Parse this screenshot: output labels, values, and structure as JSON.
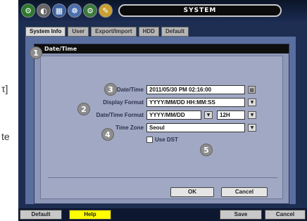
{
  "doc_fragments": [
    "τ]",
    "te"
  ],
  "window": {
    "title": "SYSTEM"
  },
  "toolbar": {
    "icons": [
      "system-icon",
      "storage-icon",
      "calendar-icon",
      "network-icon",
      "record-icon",
      "settings-icon"
    ]
  },
  "tabs": [
    {
      "label": "System Info",
      "active": true
    },
    {
      "label": "User",
      "active": false
    },
    {
      "label": "Export/Import",
      "active": false
    },
    {
      "label": "HDD",
      "active": false
    },
    {
      "label": "Default",
      "active": false
    }
  ],
  "dialog": {
    "title": "Date/Time",
    "fields": {
      "date_time": {
        "label": "Date/Time",
        "value": "2011/05/30 PM 02:16:00"
      },
      "display_format": {
        "label": "Display Format",
        "value": "YYYY/MM/DD HH:MM:SS"
      },
      "date_time_format": {
        "label": "Date/Time Format",
        "value": "YYYY/MM/DD",
        "hour_mode": "12H"
      },
      "time_zone": {
        "label": "Time Zone",
        "value": "Seoul"
      },
      "use_dst": {
        "label": "Use DST",
        "checked": false
      }
    },
    "buttons": {
      "ok": "OK",
      "cancel": "Cancel"
    }
  },
  "callouts": [
    "1",
    "2",
    "3",
    "4",
    "5"
  ],
  "bottom_bar": {
    "default": "Default",
    "help": "Help",
    "save": "Save",
    "cancel": "Cancel"
  },
  "colors": {
    "accent_help": "#ffff00",
    "background": "#1d2e52"
  }
}
